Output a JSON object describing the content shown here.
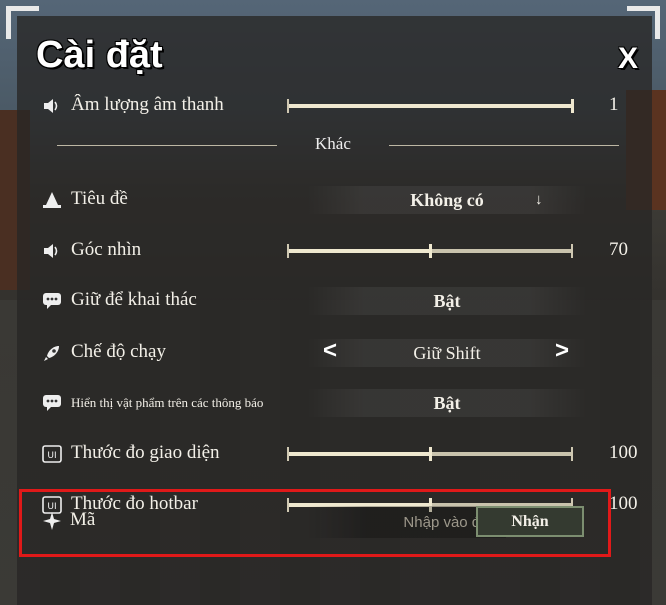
{
  "header": {
    "title": "Cài đặt",
    "close_label": "X"
  },
  "rows": {
    "volume": {
      "label": "Âm lượng âm thanh",
      "value": 1,
      "display": "1"
    },
    "divider_label": "Khác",
    "title_setting": {
      "label": "Tiêu đề",
      "value": "Không có",
      "dropdown_icon": "↓"
    },
    "fov": {
      "label": "Góc nhìn",
      "value": 70,
      "display": "70"
    },
    "hold_to_mine": {
      "label": "Giữ để khai thác",
      "value": "Bật"
    },
    "run_mode": {
      "label": "Chế độ chạy",
      "value": "Giữ Shift",
      "prev": "<",
      "next": ">"
    },
    "item_notify": {
      "label": "Hiển thị vật phẩm trên các thông báo",
      "value": "Bật"
    },
    "ui_scale": {
      "label": "Thước đo giao diện",
      "value": 100,
      "display": "100"
    },
    "hotbar_scale": {
      "label": "Thước đo hotbar",
      "value": 100,
      "display": "100"
    }
  },
  "code": {
    "label": "Mã",
    "placeholder": "Nhập vào đây",
    "button": "Nhận",
    "highlight_color": "#e01919"
  },
  "icons": {
    "volume": "speaker-icon",
    "title": "wizard-hat-icon",
    "fov": "speaker-icon",
    "hold": "chat-bubble-icon",
    "run": "rocket-icon",
    "notify": "chat-bubble-icon",
    "ui": "ui-icon",
    "hotbar": "ui-icon",
    "code": "sparkle-icon"
  }
}
